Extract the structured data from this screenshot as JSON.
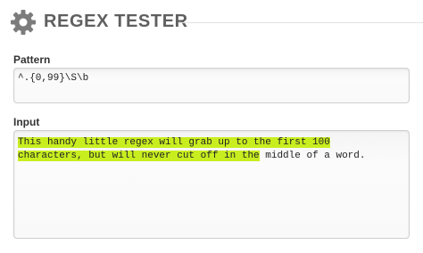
{
  "header": {
    "title": "REGEX TESTER",
    "icon": "gear-icon"
  },
  "pattern": {
    "label": "Pattern",
    "value": "^.{0,99}\\S\\b"
  },
  "input": {
    "label": "Input",
    "line1_match": "This handy little regex will grab up to the first 100",
    "line2_match": "characters, but will never cut off in the",
    "line2_rest": " middle of a word."
  },
  "colors": {
    "highlight": "#c8ee1f",
    "title_text": "#5f5f5f"
  }
}
